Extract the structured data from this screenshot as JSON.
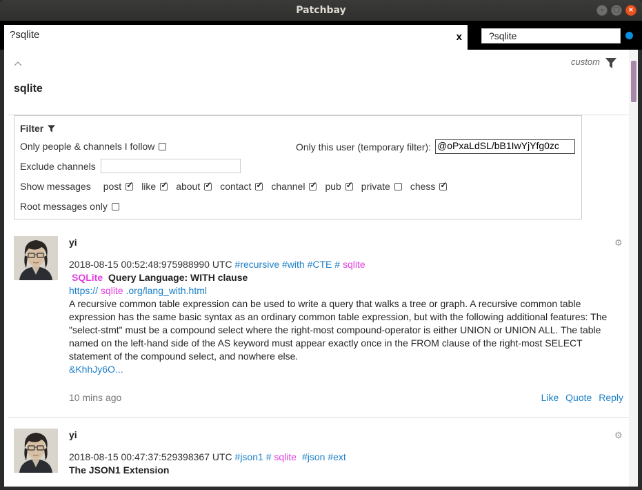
{
  "window": {
    "title": "Patchbay",
    "buttons": [
      "–",
      "▢",
      "×"
    ]
  },
  "tab": {
    "label": "?sqlite",
    "close_label": "x"
  },
  "search": {
    "value": "?sqlite"
  },
  "header": {
    "custom_label": "custom",
    "channel_title": "sqlite"
  },
  "filter": {
    "title": "Filter",
    "only_follow_label": "Only people & channels I follow",
    "only_user_label": "Only this user (temporary filter):",
    "only_user_value": "@oPxaLdSL/bB1IwYjYfg0zc",
    "exclude_label": "Exclude channels",
    "show_messages_label": "Show messages",
    "types": [
      {
        "label": "post",
        "checked": true
      },
      {
        "label": "like",
        "checked": true
      },
      {
        "label": "about",
        "checked": true
      },
      {
        "label": "contact",
        "checked": true
      },
      {
        "label": "channel",
        "checked": true
      },
      {
        "label": "pub",
        "checked": true
      },
      {
        "label": "private",
        "checked": false
      },
      {
        "label": "chess",
        "checked": true
      }
    ],
    "root_only_label": "Root messages only"
  },
  "posts": [
    {
      "author": "yi",
      "timestamp": "2018-08-15 00:52:48:975988990 UTC",
      "tags": [
        "#recursive",
        "#with",
        "#CTE",
        "#"
      ],
      "channel": "sqlite",
      "title_pink": "SQLite",
      "title_rest": "Query Language: WITH clause",
      "url_parts": [
        "https://",
        "sqlite",
        ".org/lang_with.html"
      ],
      "body": "A recursive common table expression can be used to write a query that walks a tree or graph. A recursive common table expression has the same basic syntax as an ordinary common table expression, but with the following additional features: The \"select-stmt\" must be a compound select where the right-most compound-operator is either UNION or UNION ALL. The table named on the left-hand side of the AS keyword must appear exactly once in the FROM clause of the right-most SELECT statement of the compound select, and nowhere else.",
      "ref": "&KhhJy6O...",
      "time_ago": "10 mins ago",
      "actions": [
        "Like",
        "Quote",
        "Reply"
      ]
    },
    {
      "author": "yi",
      "timestamp": "2018-08-15 00:47:37:529398367 UTC",
      "tags": [
        "#json1",
        "#"
      ],
      "channel": "sqlite",
      "tags_after": [
        "#json",
        "#ext"
      ],
      "title": "The JSON1 Extension"
    }
  ],
  "colors": {
    "link": "#1a7fc7",
    "pink": "#e23ee2",
    "status_dot": "#0a8ee0",
    "scroll_thumb": "#a888a8"
  },
  "icons": {
    "collapse": "chevron-up-icon",
    "filter": "filter-icon",
    "gear": "gear-icon"
  }
}
